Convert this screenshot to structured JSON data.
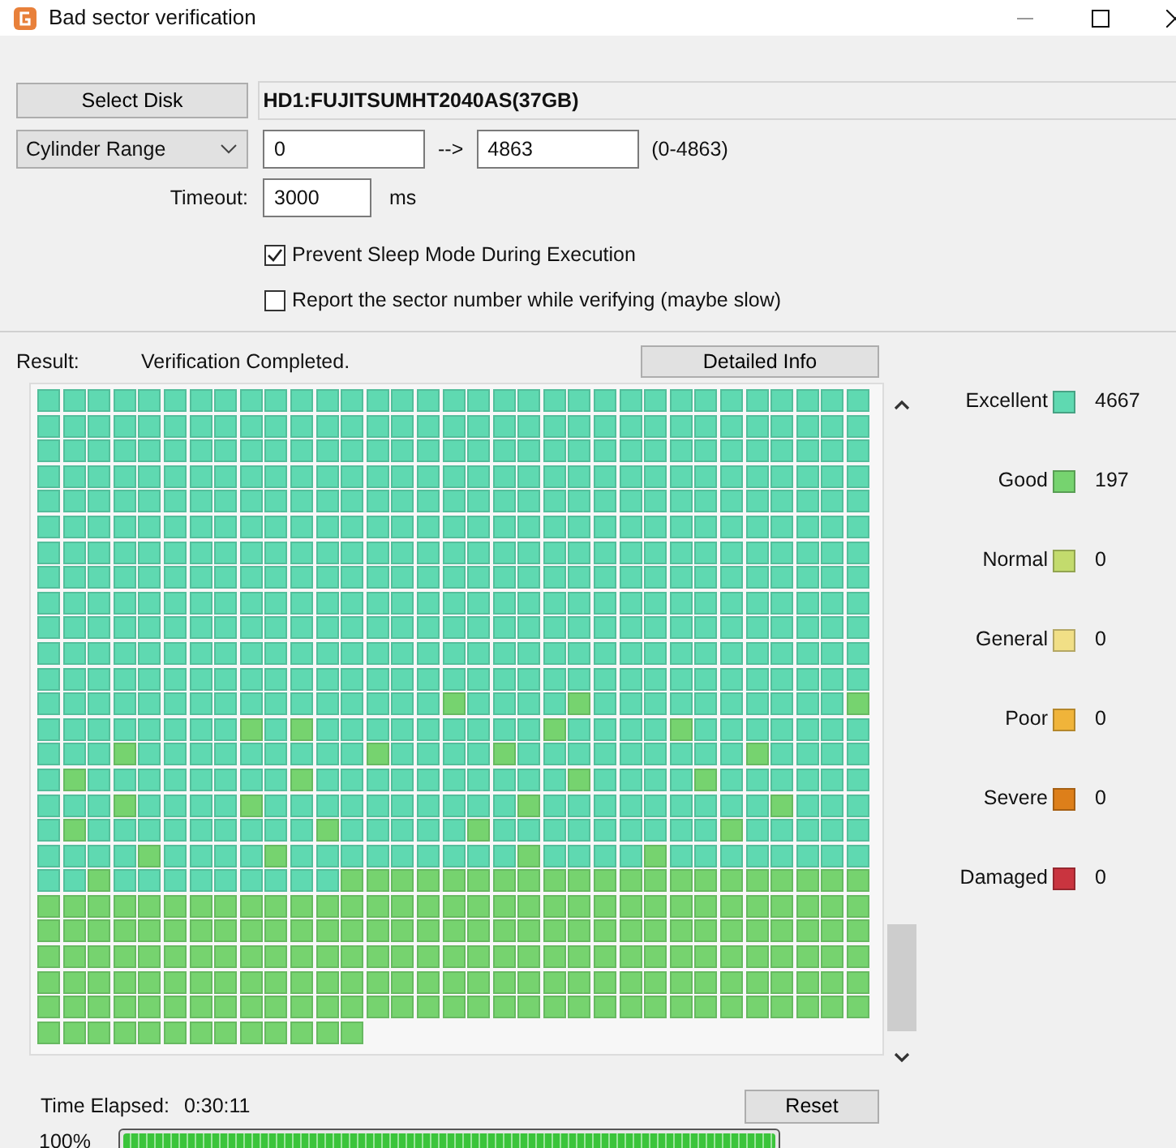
{
  "window": {
    "title": "Bad sector verification"
  },
  "disk": {
    "button": "Select Disk",
    "name": "HD1:FUJITSUMHT2040AS(37GB)"
  },
  "range": {
    "mode": "Cylinder Range",
    "from": "0",
    "arrow": "-->",
    "to": "4863",
    "hint": "(0-4863)"
  },
  "timeout": {
    "label": "Timeout:",
    "value": "3000",
    "unit": "ms"
  },
  "options": [
    {
      "label": "Prevent Sleep Mode During Execution",
      "checked": true
    },
    {
      "label": "Report the sector number while verifying (maybe slow)",
      "checked": false
    }
  ],
  "result": {
    "label": "Result:",
    "text": "Verification Completed.",
    "button": "Detailed Info"
  },
  "block_rows": [
    [
      {
        "color": "#5fd9b1"
      },
      {
        "color": "#5fd9b1"
      },
      {
        "color": "#5fd9b1"
      },
      {
        "color": "#5fd9b1"
      },
      {
        "color": "#5fd9b1"
      },
      {
        "color": "#5fd9b1"
      },
      {
        "color": "#5fd9b1"
      },
      {
        "color": "#5fd9b1"
      },
      {
        "color": "#5fd9b1"
      },
      {
        "color": "#5fd9b1"
      },
      {
        "color": "#5fd9b1"
      },
      {
        "color": "#5fd9b1"
      },
      {
        "color": "#5fd9b1"
      },
      {
        "color": "#5fd9b1"
      },
      {
        "color": "#5fd9b1"
      },
      {
        "color": "#5fd9b1"
      },
      {
        "color": "#5fd9b1"
      },
      {
        "color": "#5fd9b1"
      },
      {
        "color": "#5fd9b1"
      },
      {
        "color": "#5fd9b1"
      },
      {
        "color": "#5fd9b1"
      },
      {
        "color": "#5fd9b1"
      },
      {
        "color": "#5fd9b1"
      },
      {
        "color": "#5fd9b1"
      },
      {
        "color": "#5fd9b1"
      },
      {
        "color": "#5fd9b1"
      },
      {
        "color": "#5fd9b1"
      },
      {
        "color": "#5fd9b1"
      },
      {
        "color": "#5fd9b1"
      },
      {
        "color": "#5fd9b1"
      },
      {
        "color": "#5fd9b1"
      },
      {
        "color": "#5fd9b1"
      },
      {
        "color": "#5fd9b1"
      }
    ],
    [
      {
        "color": "#5fd9b1"
      },
      {
        "color": "#5fd9b1"
      },
      {
        "color": "#5fd9b1"
      },
      {
        "color": "#5fd9b1"
      },
      {
        "color": "#5fd9b1"
      },
      {
        "color": "#5fd9b1"
      },
      {
        "color": "#5fd9b1"
      },
      {
        "color": "#5fd9b1"
      },
      {
        "color": "#5fd9b1"
      },
      {
        "color": "#5fd9b1"
      },
      {
        "color": "#5fd9b1"
      },
      {
        "color": "#5fd9b1"
      },
      {
        "color": "#5fd9b1"
      },
      {
        "color": "#5fd9b1"
      },
      {
        "color": "#5fd9b1"
      },
      {
        "color": "#5fd9b1"
      },
      {
        "color": "#5fd9b1"
      },
      {
        "color": "#5fd9b1"
      },
      {
        "color": "#5fd9b1"
      },
      {
        "color": "#5fd9b1"
      },
      {
        "color": "#5fd9b1"
      },
      {
        "color": "#5fd9b1"
      },
      {
        "color": "#5fd9b1"
      },
      {
        "color": "#5fd9b1"
      },
      {
        "color": "#5fd9b1"
      },
      {
        "color": "#5fd9b1"
      },
      {
        "color": "#5fd9b1"
      },
      {
        "color": "#5fd9b1"
      },
      {
        "color": "#5fd9b1"
      },
      {
        "color": "#5fd9b1"
      },
      {
        "color": "#5fd9b1"
      },
      {
        "color": "#5fd9b1"
      },
      {
        "color": "#5fd9b1"
      }
    ],
    [
      {
        "color": "#5fd9b1"
      },
      {
        "color": "#5fd9b1"
      },
      {
        "color": "#5fd9b1"
      },
      {
        "color": "#5fd9b1"
      },
      {
        "color": "#5fd9b1"
      },
      {
        "color": "#5fd9b1"
      },
      {
        "color": "#5fd9b1"
      },
      {
        "color": "#5fd9b1"
      },
      {
        "color": "#5fd9b1"
      },
      {
        "color": "#5fd9b1"
      },
      {
        "color": "#5fd9b1"
      },
      {
        "color": "#5fd9b1"
      },
      {
        "color": "#5fd9b1"
      },
      {
        "color": "#5fd9b1"
      },
      {
        "color": "#5fd9b1"
      },
      {
        "color": "#5fd9b1"
      },
      {
        "color": "#5fd9b1"
      },
      {
        "color": "#5fd9b1"
      },
      {
        "color": "#5fd9b1"
      },
      {
        "color": "#5fd9b1"
      },
      {
        "color": "#5fd9b1"
      },
      {
        "color": "#5fd9b1"
      },
      {
        "color": "#5fd9b1"
      },
      {
        "color": "#5fd9b1"
      },
      {
        "color": "#5fd9b1"
      },
      {
        "color": "#5fd9b1"
      },
      {
        "color": "#5fd9b1"
      },
      {
        "color": "#5fd9b1"
      },
      {
        "color": "#5fd9b1"
      },
      {
        "color": "#5fd9b1"
      },
      {
        "color": "#5fd9b1"
      },
      {
        "color": "#5fd9b1"
      },
      {
        "color": "#5fd9b1"
      }
    ],
    [
      {
        "color": "#5fd9b1"
      },
      {
        "color": "#5fd9b1"
      },
      {
        "color": "#5fd9b1"
      },
      {
        "color": "#5fd9b1"
      },
      {
        "color": "#5fd9b1"
      },
      {
        "color": "#5fd9b1"
      },
      {
        "color": "#5fd9b1"
      },
      {
        "color": "#5fd9b1"
      },
      {
        "color": "#5fd9b1"
      },
      {
        "color": "#5fd9b1"
      },
      {
        "color": "#5fd9b1"
      },
      {
        "color": "#5fd9b1"
      },
      {
        "color": "#5fd9b1"
      },
      {
        "color": "#5fd9b1"
      },
      {
        "color": "#5fd9b1"
      },
      {
        "color": "#5fd9b1"
      },
      {
        "color": "#5fd9b1"
      },
      {
        "color": "#5fd9b1"
      },
      {
        "color": "#5fd9b1"
      },
      {
        "color": "#5fd9b1"
      },
      {
        "color": "#5fd9b1"
      },
      {
        "color": "#5fd9b1"
      },
      {
        "color": "#5fd9b1"
      },
      {
        "color": "#5fd9b1"
      },
      {
        "color": "#5fd9b1"
      },
      {
        "color": "#5fd9b1"
      },
      {
        "color": "#5fd9b1"
      },
      {
        "color": "#5fd9b1"
      },
      {
        "color": "#5fd9b1"
      },
      {
        "color": "#5fd9b1"
      },
      {
        "color": "#5fd9b1"
      },
      {
        "color": "#5fd9b1"
      },
      {
        "color": "#5fd9b1"
      }
    ],
    [
      {
        "color": "#5fd9b1"
      },
      {
        "color": "#5fd9b1"
      },
      {
        "color": "#5fd9b1"
      },
      {
        "color": "#5fd9b1"
      },
      {
        "color": "#5fd9b1"
      },
      {
        "color": "#5fd9b1"
      },
      {
        "color": "#5fd9b1"
      },
      {
        "color": "#5fd9b1"
      },
      {
        "color": "#5fd9b1"
      },
      {
        "color": "#5fd9b1"
      },
      {
        "color": "#5fd9b1"
      },
      {
        "color": "#5fd9b1"
      },
      {
        "color": "#5fd9b1"
      },
      {
        "color": "#5fd9b1"
      },
      {
        "color": "#5fd9b1"
      },
      {
        "color": "#5fd9b1"
      },
      {
        "color": "#5fd9b1"
      },
      {
        "color": "#5fd9b1"
      },
      {
        "color": "#5fd9b1"
      },
      {
        "color": "#5fd9b1"
      },
      {
        "color": "#5fd9b1"
      },
      {
        "color": "#5fd9b1"
      },
      {
        "color": "#5fd9b1"
      },
      {
        "color": "#5fd9b1"
      },
      {
        "color": "#5fd9b1"
      },
      {
        "color": "#5fd9b1"
      },
      {
        "color": "#5fd9b1"
      },
      {
        "color": "#5fd9b1"
      },
      {
        "color": "#5fd9b1"
      },
      {
        "color": "#5fd9b1"
      },
      {
        "color": "#5fd9b1"
      },
      {
        "color": "#5fd9b1"
      },
      {
        "color": "#5fd9b1"
      }
    ],
    [
      {
        "color": "#5fd9b1"
      },
      {
        "color": "#5fd9b1"
      },
      {
        "color": "#5fd9b1"
      },
      {
        "color": "#5fd9b1"
      },
      {
        "color": "#5fd9b1"
      },
      {
        "color": "#5fd9b1"
      },
      {
        "color": "#5fd9b1"
      },
      {
        "color": "#5fd9b1"
      },
      {
        "color": "#5fd9b1"
      },
      {
        "color": "#5fd9b1"
      },
      {
        "color": "#5fd9b1"
      },
      {
        "color": "#5fd9b1"
      },
      {
        "color": "#5fd9b1"
      },
      {
        "color": "#5fd9b1"
      },
      {
        "color": "#5fd9b1"
      },
      {
        "color": "#5fd9b1"
      },
      {
        "color": "#5fd9b1"
      },
      {
        "color": "#5fd9b1"
      },
      {
        "color": "#5fd9b1"
      },
      {
        "color": "#5fd9b1"
      },
      {
        "color": "#5fd9b1"
      },
      {
        "color": "#5fd9b1"
      },
      {
        "color": "#5fd9b1"
      },
      {
        "color": "#5fd9b1"
      },
      {
        "color": "#5fd9b1"
      },
      {
        "color": "#5fd9b1"
      },
      {
        "color": "#5fd9b1"
      },
      {
        "color": "#5fd9b1"
      },
      {
        "color": "#5fd9b1"
      },
      {
        "color": "#5fd9b1"
      },
      {
        "color": "#5fd9b1"
      },
      {
        "color": "#5fd9b1"
      },
      {
        "color": "#5fd9b1"
      }
    ],
    [
      {
        "color": "#5fd9b1"
      },
      {
        "color": "#5fd9b1"
      },
      {
        "color": "#5fd9b1"
      },
      {
        "color": "#5fd9b1"
      },
      {
        "color": "#5fd9b1"
      },
      {
        "color": "#5fd9b1"
      },
      {
        "color": "#5fd9b1"
      },
      {
        "color": "#5fd9b1"
      },
      {
        "color": "#5fd9b1"
      },
      {
        "color": "#5fd9b1"
      },
      {
        "color": "#5fd9b1"
      },
      {
        "color": "#5fd9b1"
      },
      {
        "color": "#5fd9b1"
      },
      {
        "color": "#5fd9b1"
      },
      {
        "color": "#5fd9b1"
      },
      {
        "color": "#5fd9b1"
      },
      {
        "color": "#5fd9b1"
      },
      {
        "color": "#5fd9b1"
      },
      {
        "color": "#5fd9b1"
      },
      {
        "color": "#5fd9b1"
      },
      {
        "color": "#5fd9b1"
      },
      {
        "color": "#5fd9b1"
      },
      {
        "color": "#5fd9b1"
      },
      {
        "color": "#5fd9b1"
      },
      {
        "color": "#5fd9b1"
      },
      {
        "color": "#5fd9b1"
      },
      {
        "color": "#5fd9b1"
      },
      {
        "color": "#5fd9b1"
      },
      {
        "color": "#5fd9b1"
      },
      {
        "color": "#5fd9b1"
      },
      {
        "color": "#5fd9b1"
      },
      {
        "color": "#5fd9b1"
      },
      {
        "color": "#5fd9b1"
      }
    ],
    [
      {
        "color": "#5fd9b1"
      },
      {
        "color": "#5fd9b1"
      },
      {
        "color": "#5fd9b1"
      },
      {
        "color": "#5fd9b1"
      },
      {
        "color": "#5fd9b1"
      },
      {
        "color": "#5fd9b1"
      },
      {
        "color": "#5fd9b1"
      },
      {
        "color": "#5fd9b1"
      },
      {
        "color": "#5fd9b1"
      },
      {
        "color": "#5fd9b1"
      },
      {
        "color": "#5fd9b1"
      },
      {
        "color": "#5fd9b1"
      },
      {
        "color": "#5fd9b1"
      },
      {
        "color": "#5fd9b1"
      },
      {
        "color": "#5fd9b1"
      },
      {
        "color": "#5fd9b1"
      },
      {
        "color": "#5fd9b1"
      },
      {
        "color": "#5fd9b1"
      },
      {
        "color": "#5fd9b1"
      },
      {
        "color": "#5fd9b1"
      },
      {
        "color": "#5fd9b1"
      },
      {
        "color": "#5fd9b1"
      },
      {
        "color": "#5fd9b1"
      },
      {
        "color": "#5fd9b1"
      },
      {
        "color": "#5fd9b1"
      },
      {
        "color": "#5fd9b1"
      },
      {
        "color": "#5fd9b1"
      },
      {
        "color": "#5fd9b1"
      },
      {
        "color": "#5fd9b1"
      },
      {
        "color": "#5fd9b1"
      },
      {
        "color": "#5fd9b1"
      },
      {
        "color": "#5fd9b1"
      },
      {
        "color": "#5fd9b1"
      }
    ],
    [
      {
        "color": "#5fd9b1"
      },
      {
        "color": "#5fd9b1"
      },
      {
        "color": "#5fd9b1"
      },
      {
        "color": "#5fd9b1"
      },
      {
        "color": "#5fd9b1"
      },
      {
        "color": "#5fd9b1"
      },
      {
        "color": "#5fd9b1"
      },
      {
        "color": "#5fd9b1"
      },
      {
        "color": "#5fd9b1"
      },
      {
        "color": "#5fd9b1"
      },
      {
        "color": "#5fd9b1"
      },
      {
        "color": "#5fd9b1"
      },
      {
        "color": "#5fd9b1"
      },
      {
        "color": "#5fd9b1"
      },
      {
        "color": "#5fd9b1"
      },
      {
        "color": "#5fd9b1"
      },
      {
        "color": "#5fd9b1"
      },
      {
        "color": "#5fd9b1"
      },
      {
        "color": "#5fd9b1"
      },
      {
        "color": "#5fd9b1"
      },
      {
        "color": "#5fd9b1"
      },
      {
        "color": "#5fd9b1"
      },
      {
        "color": "#5fd9b1"
      },
      {
        "color": "#5fd9b1"
      },
      {
        "color": "#5fd9b1"
      },
      {
        "color": "#5fd9b1"
      },
      {
        "color": "#5fd9b1"
      },
      {
        "color": "#5fd9b1"
      },
      {
        "color": "#5fd9b1"
      },
      {
        "color": "#5fd9b1"
      },
      {
        "color": "#5fd9b1"
      },
      {
        "color": "#5fd9b1"
      },
      {
        "color": "#5fd9b1"
      }
    ],
    [
      {
        "color": "#5fd9b1"
      },
      {
        "color": "#5fd9b1"
      },
      {
        "color": "#5fd9b1"
      },
      {
        "color": "#5fd9b1"
      },
      {
        "color": "#5fd9b1"
      },
      {
        "color": "#5fd9b1"
      },
      {
        "color": "#5fd9b1"
      },
      {
        "color": "#5fd9b1"
      },
      {
        "color": "#5fd9b1"
      },
      {
        "color": "#5fd9b1"
      },
      {
        "color": "#5fd9b1"
      },
      {
        "color": "#5fd9b1"
      },
      {
        "color": "#5fd9b1"
      },
      {
        "color": "#5fd9b1"
      },
      {
        "color": "#5fd9b1"
      },
      {
        "color": "#5fd9b1"
      },
      {
        "color": "#5fd9b1"
      },
      {
        "color": "#5fd9b1"
      },
      {
        "color": "#5fd9b1"
      },
      {
        "color": "#5fd9b1"
      },
      {
        "color": "#5fd9b1"
      },
      {
        "color": "#5fd9b1"
      },
      {
        "color": "#5fd9b1"
      },
      {
        "color": "#5fd9b1"
      },
      {
        "color": "#5fd9b1"
      },
      {
        "color": "#5fd9b1"
      },
      {
        "color": "#5fd9b1"
      },
      {
        "color": "#5fd9b1"
      },
      {
        "color": "#5fd9b1"
      },
      {
        "color": "#5fd9b1"
      },
      {
        "color": "#5fd9b1"
      },
      {
        "color": "#5fd9b1"
      },
      {
        "color": "#5fd9b1"
      }
    ],
    [
      {
        "color": "#5fd9b1"
      },
      {
        "color": "#5fd9b1"
      },
      {
        "color": "#5fd9b1"
      },
      {
        "color": "#5fd9b1"
      },
      {
        "color": "#5fd9b1"
      },
      {
        "color": "#5fd9b1"
      },
      {
        "color": "#5fd9b1"
      },
      {
        "color": "#5fd9b1"
      },
      {
        "color": "#5fd9b1"
      },
      {
        "color": "#5fd9b1"
      },
      {
        "color": "#5fd9b1"
      },
      {
        "color": "#5fd9b1"
      },
      {
        "color": "#5fd9b1"
      },
      {
        "color": "#5fd9b1"
      },
      {
        "color": "#5fd9b1"
      },
      {
        "color": "#5fd9b1"
      },
      {
        "color": "#5fd9b1"
      },
      {
        "color": "#5fd9b1"
      },
      {
        "color": "#5fd9b1"
      },
      {
        "color": "#5fd9b1"
      },
      {
        "color": "#5fd9b1"
      },
      {
        "color": "#5fd9b1"
      },
      {
        "color": "#5fd9b1"
      },
      {
        "color": "#5fd9b1"
      },
      {
        "color": "#5fd9b1"
      },
      {
        "color": "#5fd9b1"
      },
      {
        "color": "#5fd9b1"
      },
      {
        "color": "#5fd9b1"
      },
      {
        "color": "#5fd9b1"
      },
      {
        "color": "#5fd9b1"
      },
      {
        "color": "#5fd9b1"
      },
      {
        "color": "#5fd9b1"
      },
      {
        "color": "#5fd9b1"
      }
    ],
    [
      {
        "color": "#5fd9b1"
      },
      {
        "color": "#5fd9b1"
      },
      {
        "color": "#5fd9b1"
      },
      {
        "color": "#5fd9b1"
      },
      {
        "color": "#5fd9b1"
      },
      {
        "color": "#5fd9b1"
      },
      {
        "color": "#5fd9b1"
      },
      {
        "color": "#5fd9b1"
      },
      {
        "color": "#5fd9b1"
      },
      {
        "color": "#5fd9b1"
      },
      {
        "color": "#5fd9b1"
      },
      {
        "color": "#5fd9b1"
      },
      {
        "color": "#5fd9b1"
      },
      {
        "color": "#5fd9b1"
      },
      {
        "color": "#5fd9b1"
      },
      {
        "color": "#5fd9b1"
      },
      {
        "color": "#5fd9b1"
      },
      {
        "color": "#5fd9b1"
      },
      {
        "color": "#5fd9b1"
      },
      {
        "color": "#5fd9b1"
      },
      {
        "color": "#5fd9b1"
      },
      {
        "color": "#5fd9b1"
      },
      {
        "color": "#5fd9b1"
      },
      {
        "color": "#5fd9b1"
      },
      {
        "color": "#5fd9b1"
      },
      {
        "color": "#5fd9b1"
      },
      {
        "color": "#5fd9b1"
      },
      {
        "color": "#5fd9b1"
      },
      {
        "color": "#5fd9b1"
      },
      {
        "color": "#5fd9b1"
      },
      {
        "color": "#5fd9b1"
      },
      {
        "color": "#5fd9b1"
      },
      {
        "color": "#5fd9b1"
      }
    ],
    [
      {
        "color": "#5fd9b1"
      },
      {
        "color": "#5fd9b1"
      },
      {
        "color": "#5fd9b1"
      },
      {
        "color": "#5fd9b1"
      },
      {
        "color": "#5fd9b1"
      },
      {
        "color": "#5fd9b1"
      },
      {
        "color": "#5fd9b1"
      },
      {
        "color": "#5fd9b1"
      },
      {
        "color": "#5fd9b1"
      },
      {
        "color": "#5fd9b1"
      },
      {
        "color": "#5fd9b1"
      },
      {
        "color": "#5fd9b1"
      },
      {
        "color": "#5fd9b1"
      },
      {
        "color": "#5fd9b1"
      },
      {
        "color": "#5fd9b1"
      },
      {
        "color": "#5fd9b1"
      },
      {
        "color": "#76d36f"
      },
      {
        "color": "#5fd9b1"
      },
      {
        "color": "#5fd9b1"
      },
      {
        "color": "#5fd9b1"
      },
      {
        "color": "#5fd9b1"
      },
      {
        "color": "#76d36f"
      },
      {
        "color": "#5fd9b1"
      },
      {
        "color": "#5fd9b1"
      },
      {
        "color": "#5fd9b1"
      },
      {
        "color": "#5fd9b1"
      },
      {
        "color": "#5fd9b1"
      },
      {
        "color": "#5fd9b1"
      },
      {
        "color": "#5fd9b1"
      },
      {
        "color": "#5fd9b1"
      },
      {
        "color": "#5fd9b1"
      },
      {
        "color": "#5fd9b1"
      },
      {
        "color": "#76d36f"
      }
    ],
    [
      {
        "color": "#5fd9b1"
      },
      {
        "color": "#5fd9b1"
      },
      {
        "color": "#5fd9b1"
      },
      {
        "color": "#5fd9b1"
      },
      {
        "color": "#5fd9b1"
      },
      {
        "color": "#5fd9b1"
      },
      {
        "color": "#5fd9b1"
      },
      {
        "color": "#5fd9b1"
      },
      {
        "color": "#76d36f"
      },
      {
        "color": "#5fd9b1"
      },
      {
        "color": "#76d36f"
      },
      {
        "color": "#5fd9b1"
      },
      {
        "color": "#5fd9b1"
      },
      {
        "color": "#5fd9b1"
      },
      {
        "color": "#5fd9b1"
      },
      {
        "color": "#5fd9b1"
      },
      {
        "color": "#5fd9b1"
      },
      {
        "color": "#5fd9b1"
      },
      {
        "color": "#5fd9b1"
      },
      {
        "color": "#5fd9b1"
      },
      {
        "color": "#76d36f"
      },
      {
        "color": "#5fd9b1"
      },
      {
        "color": "#5fd9b1"
      },
      {
        "color": "#5fd9b1"
      },
      {
        "color": "#5fd9b1"
      },
      {
        "color": "#76d36f"
      },
      {
        "color": "#5fd9b1"
      },
      {
        "color": "#5fd9b1"
      },
      {
        "color": "#5fd9b1"
      },
      {
        "color": "#5fd9b1"
      },
      {
        "color": "#5fd9b1"
      },
      {
        "color": "#5fd9b1"
      },
      {
        "color": "#5fd9b1"
      }
    ],
    [
      {
        "color": "#5fd9b1"
      },
      {
        "color": "#5fd9b1"
      },
      {
        "color": "#5fd9b1"
      },
      {
        "color": "#76d36f"
      },
      {
        "color": "#5fd9b1"
      },
      {
        "color": "#5fd9b1"
      },
      {
        "color": "#5fd9b1"
      },
      {
        "color": "#5fd9b1"
      },
      {
        "color": "#5fd9b1"
      },
      {
        "color": "#5fd9b1"
      },
      {
        "color": "#5fd9b1"
      },
      {
        "color": "#5fd9b1"
      },
      {
        "color": "#5fd9b1"
      },
      {
        "color": "#76d36f"
      },
      {
        "color": "#5fd9b1"
      },
      {
        "color": "#5fd9b1"
      },
      {
        "color": "#5fd9b1"
      },
      {
        "color": "#5fd9b1"
      },
      {
        "color": "#76d36f"
      },
      {
        "color": "#5fd9b1"
      },
      {
        "color": "#5fd9b1"
      },
      {
        "color": "#5fd9b1"
      },
      {
        "color": "#5fd9b1"
      },
      {
        "color": "#5fd9b1"
      },
      {
        "color": "#5fd9b1"
      },
      {
        "color": "#5fd9b1"
      },
      {
        "color": "#5fd9b1"
      },
      {
        "color": "#5fd9b1"
      },
      {
        "color": "#76d36f"
      },
      {
        "color": "#5fd9b1"
      },
      {
        "color": "#5fd9b1"
      },
      {
        "color": "#5fd9b1"
      },
      {
        "color": "#5fd9b1"
      }
    ],
    [
      {
        "color": "#5fd9b1"
      },
      {
        "color": "#76d36f"
      },
      {
        "color": "#5fd9b1"
      },
      {
        "color": "#5fd9b1"
      },
      {
        "color": "#5fd9b1"
      },
      {
        "color": "#5fd9b1"
      },
      {
        "color": "#5fd9b1"
      },
      {
        "color": "#5fd9b1"
      },
      {
        "color": "#5fd9b1"
      },
      {
        "color": "#5fd9b1"
      },
      {
        "color": "#76d36f"
      },
      {
        "color": "#5fd9b1"
      },
      {
        "color": "#5fd9b1"
      },
      {
        "color": "#5fd9b1"
      },
      {
        "color": "#5fd9b1"
      },
      {
        "color": "#5fd9b1"
      },
      {
        "color": "#5fd9b1"
      },
      {
        "color": "#5fd9b1"
      },
      {
        "color": "#5fd9b1"
      },
      {
        "color": "#5fd9b1"
      },
      {
        "color": "#5fd9b1"
      },
      {
        "color": "#76d36f"
      },
      {
        "color": "#5fd9b1"
      },
      {
        "color": "#5fd9b1"
      },
      {
        "color": "#5fd9b1"
      },
      {
        "color": "#5fd9b1"
      },
      {
        "color": "#76d36f"
      },
      {
        "color": "#5fd9b1"
      },
      {
        "color": "#5fd9b1"
      },
      {
        "color": "#5fd9b1"
      },
      {
        "color": "#5fd9b1"
      },
      {
        "color": "#5fd9b1"
      },
      {
        "color": "#5fd9b1"
      }
    ],
    [
      {
        "color": "#5fd9b1"
      },
      {
        "color": "#5fd9b1"
      },
      {
        "color": "#5fd9b1"
      },
      {
        "color": "#76d36f"
      },
      {
        "color": "#5fd9b1"
      },
      {
        "color": "#5fd9b1"
      },
      {
        "color": "#5fd9b1"
      },
      {
        "color": "#5fd9b1"
      },
      {
        "color": "#76d36f"
      },
      {
        "color": "#5fd9b1"
      },
      {
        "color": "#5fd9b1"
      },
      {
        "color": "#5fd9b1"
      },
      {
        "color": "#5fd9b1"
      },
      {
        "color": "#5fd9b1"
      },
      {
        "color": "#5fd9b1"
      },
      {
        "color": "#5fd9b1"
      },
      {
        "color": "#5fd9b1"
      },
      {
        "color": "#5fd9b1"
      },
      {
        "color": "#5fd9b1"
      },
      {
        "color": "#76d36f"
      },
      {
        "color": "#5fd9b1"
      },
      {
        "color": "#5fd9b1"
      },
      {
        "color": "#5fd9b1"
      },
      {
        "color": "#5fd9b1"
      },
      {
        "color": "#5fd9b1"
      },
      {
        "color": "#5fd9b1"
      },
      {
        "color": "#5fd9b1"
      },
      {
        "color": "#5fd9b1"
      },
      {
        "color": "#5fd9b1"
      },
      {
        "color": "#76d36f"
      },
      {
        "color": "#5fd9b1"
      },
      {
        "color": "#5fd9b1"
      },
      {
        "color": "#5fd9b1"
      }
    ],
    [
      {
        "color": "#5fd9b1"
      },
      {
        "color": "#76d36f"
      },
      {
        "color": "#5fd9b1"
      },
      {
        "color": "#5fd9b1"
      },
      {
        "color": "#5fd9b1"
      },
      {
        "color": "#5fd9b1"
      },
      {
        "color": "#5fd9b1"
      },
      {
        "color": "#5fd9b1"
      },
      {
        "color": "#5fd9b1"
      },
      {
        "color": "#5fd9b1"
      },
      {
        "color": "#5fd9b1"
      },
      {
        "color": "#76d36f"
      },
      {
        "color": "#5fd9b1"
      },
      {
        "color": "#5fd9b1"
      },
      {
        "color": "#5fd9b1"
      },
      {
        "color": "#5fd9b1"
      },
      {
        "color": "#5fd9b1"
      },
      {
        "color": "#76d36f"
      },
      {
        "color": "#5fd9b1"
      },
      {
        "color": "#5fd9b1"
      },
      {
        "color": "#5fd9b1"
      },
      {
        "color": "#5fd9b1"
      },
      {
        "color": "#5fd9b1"
      },
      {
        "color": "#5fd9b1"
      },
      {
        "color": "#5fd9b1"
      },
      {
        "color": "#5fd9b1"
      },
      {
        "color": "#5fd9b1"
      },
      {
        "color": "#76d36f"
      },
      {
        "color": "#5fd9b1"
      },
      {
        "color": "#5fd9b1"
      },
      {
        "color": "#5fd9b1"
      },
      {
        "color": "#5fd9b1"
      },
      {
        "color": "#5fd9b1"
      }
    ],
    [
      {
        "color": "#5fd9b1"
      },
      {
        "color": "#5fd9b1"
      },
      {
        "color": "#5fd9b1"
      },
      {
        "color": "#5fd9b1"
      },
      {
        "color": "#76d36f"
      },
      {
        "color": "#5fd9b1"
      },
      {
        "color": "#5fd9b1"
      },
      {
        "color": "#5fd9b1"
      },
      {
        "color": "#5fd9b1"
      },
      {
        "color": "#76d36f"
      },
      {
        "color": "#5fd9b1"
      },
      {
        "color": "#5fd9b1"
      },
      {
        "color": "#5fd9b1"
      },
      {
        "color": "#5fd9b1"
      },
      {
        "color": "#5fd9b1"
      },
      {
        "color": "#5fd9b1"
      },
      {
        "color": "#5fd9b1"
      },
      {
        "color": "#5fd9b1"
      },
      {
        "color": "#5fd9b1"
      },
      {
        "color": "#76d36f"
      },
      {
        "color": "#5fd9b1"
      },
      {
        "color": "#5fd9b1"
      },
      {
        "color": "#5fd9b1"
      },
      {
        "color": "#5fd9b1"
      },
      {
        "color": "#76d36f"
      },
      {
        "color": "#5fd9b1"
      },
      {
        "color": "#5fd9b1"
      },
      {
        "color": "#5fd9b1"
      },
      {
        "color": "#5fd9b1"
      },
      {
        "color": "#5fd9b1"
      },
      {
        "color": "#5fd9b1"
      },
      {
        "color": "#5fd9b1"
      },
      {
        "color": "#5fd9b1"
      }
    ],
    [
      {
        "color": "#5fd9b1"
      },
      {
        "color": "#5fd9b1"
      },
      {
        "color": "#76d36f"
      },
      {
        "color": "#5fd9b1"
      },
      {
        "color": "#5fd9b1"
      },
      {
        "color": "#5fd9b1"
      },
      {
        "color": "#5fd9b1"
      },
      {
        "color": "#5fd9b1"
      },
      {
        "color": "#5fd9b1"
      },
      {
        "color": "#5fd9b1"
      },
      {
        "color": "#5fd9b1"
      },
      {
        "color": "#5fd9b1"
      },
      {
        "color": "#76d36f"
      },
      {
        "color": "#76d36f"
      },
      {
        "color": "#76d36f"
      },
      {
        "color": "#76d36f"
      },
      {
        "color": "#76d36f"
      },
      {
        "color": "#76d36f"
      },
      {
        "color": "#76d36f"
      },
      {
        "color": "#76d36f"
      },
      {
        "color": "#76d36f"
      },
      {
        "color": "#76d36f"
      },
      {
        "color": "#76d36f"
      },
      {
        "color": "#76d36f"
      },
      {
        "color": "#76d36f"
      },
      {
        "color": "#76d36f"
      },
      {
        "color": "#76d36f"
      },
      {
        "color": "#76d36f"
      },
      {
        "color": "#76d36f"
      },
      {
        "color": "#76d36f"
      },
      {
        "color": "#76d36f"
      },
      {
        "color": "#76d36f"
      },
      {
        "color": "#76d36f"
      }
    ],
    [
      {
        "color": "#76d36f"
      },
      {
        "color": "#76d36f"
      },
      {
        "color": "#76d36f"
      },
      {
        "color": "#76d36f"
      },
      {
        "color": "#76d36f"
      },
      {
        "color": "#76d36f"
      },
      {
        "color": "#76d36f"
      },
      {
        "color": "#76d36f"
      },
      {
        "color": "#76d36f"
      },
      {
        "color": "#76d36f"
      },
      {
        "color": "#76d36f"
      },
      {
        "color": "#76d36f"
      },
      {
        "color": "#76d36f"
      },
      {
        "color": "#76d36f"
      },
      {
        "color": "#76d36f"
      },
      {
        "color": "#76d36f"
      },
      {
        "color": "#76d36f"
      },
      {
        "color": "#76d36f"
      },
      {
        "color": "#76d36f"
      },
      {
        "color": "#76d36f"
      },
      {
        "color": "#76d36f"
      },
      {
        "color": "#76d36f"
      },
      {
        "color": "#76d36f"
      },
      {
        "color": "#76d36f"
      },
      {
        "color": "#76d36f"
      },
      {
        "color": "#76d36f"
      },
      {
        "color": "#76d36f"
      },
      {
        "color": "#76d36f"
      },
      {
        "color": "#76d36f"
      },
      {
        "color": "#76d36f"
      },
      {
        "color": "#76d36f"
      },
      {
        "color": "#76d36f"
      },
      {
        "color": "#76d36f"
      }
    ],
    [
      {
        "color": "#76d36f"
      },
      {
        "color": "#76d36f"
      },
      {
        "color": "#76d36f"
      },
      {
        "color": "#76d36f"
      },
      {
        "color": "#76d36f"
      },
      {
        "color": "#76d36f"
      },
      {
        "color": "#76d36f"
      },
      {
        "color": "#76d36f"
      },
      {
        "color": "#76d36f"
      },
      {
        "color": "#76d36f"
      },
      {
        "color": "#76d36f"
      },
      {
        "color": "#76d36f"
      },
      {
        "color": "#76d36f"
      },
      {
        "color": "#76d36f"
      },
      {
        "color": "#76d36f"
      },
      {
        "color": "#76d36f"
      },
      {
        "color": "#76d36f"
      },
      {
        "color": "#76d36f"
      },
      {
        "color": "#76d36f"
      },
      {
        "color": "#76d36f"
      },
      {
        "color": "#76d36f"
      },
      {
        "color": "#76d36f"
      },
      {
        "color": "#76d36f"
      },
      {
        "color": "#76d36f"
      },
      {
        "color": "#76d36f"
      },
      {
        "color": "#76d36f"
      },
      {
        "color": "#76d36f"
      },
      {
        "color": "#76d36f"
      },
      {
        "color": "#76d36f"
      },
      {
        "color": "#76d36f"
      },
      {
        "color": "#76d36f"
      },
      {
        "color": "#76d36f"
      },
      {
        "color": "#76d36f"
      }
    ],
    [
      {
        "color": "#76d36f"
      },
      {
        "color": "#76d36f"
      },
      {
        "color": "#76d36f"
      },
      {
        "color": "#76d36f"
      },
      {
        "color": "#76d36f"
      },
      {
        "color": "#76d36f"
      },
      {
        "color": "#76d36f"
      },
      {
        "color": "#76d36f"
      },
      {
        "color": "#76d36f"
      },
      {
        "color": "#76d36f"
      },
      {
        "color": "#76d36f"
      },
      {
        "color": "#76d36f"
      },
      {
        "color": "#76d36f"
      },
      {
        "color": "#76d36f"
      },
      {
        "color": "#76d36f"
      },
      {
        "color": "#76d36f"
      },
      {
        "color": "#76d36f"
      },
      {
        "color": "#76d36f"
      },
      {
        "color": "#76d36f"
      },
      {
        "color": "#76d36f"
      },
      {
        "color": "#76d36f"
      },
      {
        "color": "#76d36f"
      },
      {
        "color": "#76d36f"
      },
      {
        "color": "#76d36f"
      },
      {
        "color": "#76d36f"
      },
      {
        "color": "#76d36f"
      },
      {
        "color": "#76d36f"
      },
      {
        "color": "#76d36f"
      },
      {
        "color": "#76d36f"
      },
      {
        "color": "#76d36f"
      },
      {
        "color": "#76d36f"
      },
      {
        "color": "#76d36f"
      },
      {
        "color": "#76d36f"
      }
    ],
    [
      {
        "color": "#76d36f"
      },
      {
        "color": "#76d36f"
      },
      {
        "color": "#76d36f"
      },
      {
        "color": "#76d36f"
      },
      {
        "color": "#76d36f"
      },
      {
        "color": "#76d36f"
      },
      {
        "color": "#76d36f"
      },
      {
        "color": "#76d36f"
      },
      {
        "color": "#76d36f"
      },
      {
        "color": "#76d36f"
      },
      {
        "color": "#76d36f"
      },
      {
        "color": "#76d36f"
      },
      {
        "color": "#76d36f"
      },
      {
        "color": "#76d36f"
      },
      {
        "color": "#76d36f"
      },
      {
        "color": "#76d36f"
      },
      {
        "color": "#76d36f"
      },
      {
        "color": "#76d36f"
      },
      {
        "color": "#76d36f"
      },
      {
        "color": "#76d36f"
      },
      {
        "color": "#76d36f"
      },
      {
        "color": "#76d36f"
      },
      {
        "color": "#76d36f"
      },
      {
        "color": "#76d36f"
      },
      {
        "color": "#76d36f"
      },
      {
        "color": "#76d36f"
      },
      {
        "color": "#76d36f"
      },
      {
        "color": "#76d36f"
      },
      {
        "color": "#76d36f"
      },
      {
        "color": "#76d36f"
      },
      {
        "color": "#76d36f"
      },
      {
        "color": "#76d36f"
      },
      {
        "color": "#76d36f"
      }
    ],
    [
      {
        "color": "#76d36f"
      },
      {
        "color": "#76d36f"
      },
      {
        "color": "#76d36f"
      },
      {
        "color": "#76d36f"
      },
      {
        "color": "#76d36f"
      },
      {
        "color": "#76d36f"
      },
      {
        "color": "#76d36f"
      },
      {
        "color": "#76d36f"
      },
      {
        "color": "#76d36f"
      },
      {
        "color": "#76d36f"
      },
      {
        "color": "#76d36f"
      },
      {
        "color": "#76d36f"
      },
      {
        "color": "#76d36f"
      },
      {
        "color": "#76d36f"
      },
      {
        "color": "#76d36f"
      },
      {
        "color": "#76d36f"
      },
      {
        "color": "#76d36f"
      },
      {
        "color": "#76d36f"
      },
      {
        "color": "#76d36f"
      },
      {
        "color": "#76d36f"
      },
      {
        "color": "#76d36f"
      },
      {
        "color": "#76d36f"
      },
      {
        "color": "#76d36f"
      },
      {
        "color": "#76d36f"
      },
      {
        "color": "#76d36f"
      },
      {
        "color": "#76d36f"
      },
      {
        "color": "#76d36f"
      },
      {
        "color": "#76d36f"
      },
      {
        "color": "#76d36f"
      },
      {
        "color": "#76d36f"
      },
      {
        "color": "#76d36f"
      },
      {
        "color": "#76d36f"
      },
      {
        "color": "#76d36f"
      }
    ],
    [
      {
        "color": "#76d36f"
      },
      {
        "color": "#76d36f"
      },
      {
        "color": "#76d36f"
      },
      {
        "color": "#76d36f"
      },
      {
        "color": "#76d36f"
      },
      {
        "color": "#76d36f"
      },
      {
        "color": "#76d36f"
      },
      {
        "color": "#76d36f"
      },
      {
        "color": "#76d36f"
      },
      {
        "color": "#76d36f"
      },
      {
        "color": "#76d36f"
      },
      {
        "color": "#76d36f"
      },
      {
        "color": "#76d36f"
      }
    ]
  ],
  "legend": [
    {
      "label": "Excellent",
      "color": "#5fd9b1",
      "count": "4667"
    },
    {
      "label": "Good",
      "color": "#76d36f",
      "count": "197"
    },
    {
      "label": "Normal",
      "color": "#c3db6d",
      "count": "0"
    },
    {
      "label": "General",
      "color": "#f1df86",
      "count": "0"
    },
    {
      "label": "Poor",
      "color": "#f0b43a",
      "count": "0"
    },
    {
      "label": "Severe",
      "color": "#dd7f1a",
      "count": "0"
    },
    {
      "label": "Damaged",
      "color": "#c9343f",
      "count": "0"
    }
  ],
  "footer": {
    "elapsed_label": "Time Elapsed:",
    "elapsed": "0:30:11",
    "reset": "Reset",
    "percent": "100%",
    "level": 1
  }
}
